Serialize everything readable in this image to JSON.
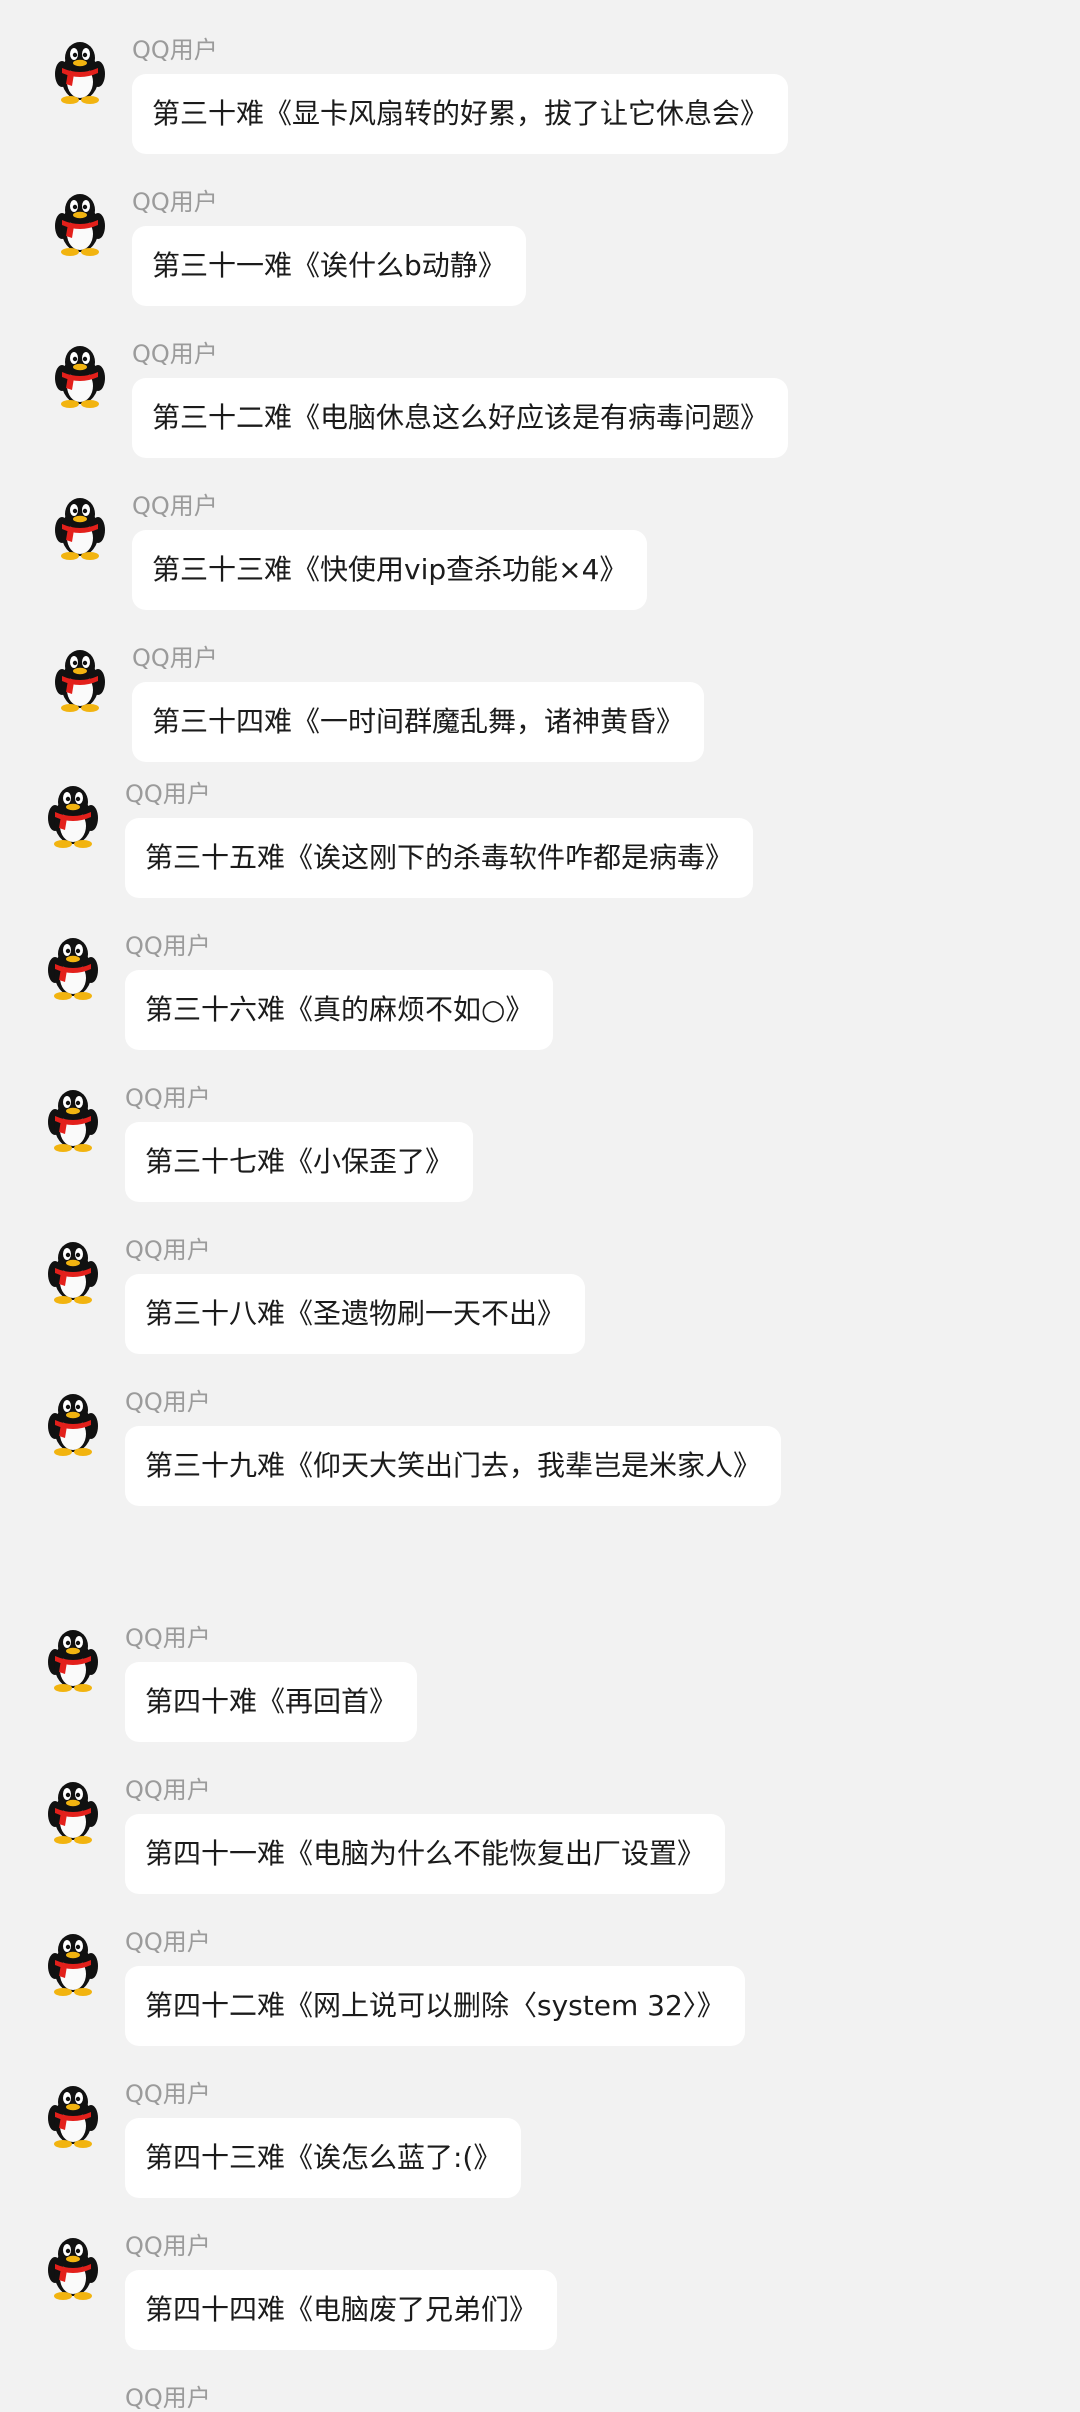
{
  "messages": [
    {
      "sender": "QQ用户",
      "text": "第三十难《显卡风扇转的好累，拔了让它休息会》"
    },
    {
      "sender": "QQ用户",
      "text": "第三十一难《诶什么b动静》"
    },
    {
      "sender": "QQ用户",
      "text": "第三十二难《电脑休息这么好应该是有病毒问题》"
    },
    {
      "sender": "QQ用户",
      "text": "第三十三难《快使用vip查杀功能×4》"
    },
    {
      "sender": "QQ用户",
      "text": "第三十四难《一时间群魔乱舞，诸神黄昏》"
    },
    {
      "sender": "QQ用户",
      "text": "第三十五难《诶这刚下的杀毒软件咋都是病毒》"
    },
    {
      "sender": "QQ用户",
      "text": "第三十六难《真的麻烦不如○》"
    },
    {
      "sender": "QQ用户",
      "text": "第三十七难《小保歪了》"
    },
    {
      "sender": "QQ用户",
      "text": "第三十八难《圣遗物刷一天不出》"
    },
    {
      "sender": "QQ用户",
      "text": "第三十九难《仰天大笑出门去，我辈岂是米家人》"
    },
    {
      "sender": "QQ用户",
      "text": "第四十难《再回首》"
    },
    {
      "sender": "QQ用户",
      "text": "第四十一难《电脑为什么不能恢复出厂设置》"
    },
    {
      "sender": "QQ用户",
      "text": "第四十二难《网上说可以删除〈system 32〉》"
    },
    {
      "sender": "QQ用户",
      "text": "第四十三难《诶怎么蓝了:(》"
    },
    {
      "sender": "QQ用户",
      "text": "第四十四难《电脑废了兄弟们》"
    }
  ],
  "partial_last_sender": "QQ用户",
  "avatar_icon": "qq-penguin-icon",
  "colors": {
    "background": "#f2f2f2",
    "bubble": "#ffffff",
    "sender_text": "#9b9b9b",
    "message_text": "#1b1b1b"
  }
}
